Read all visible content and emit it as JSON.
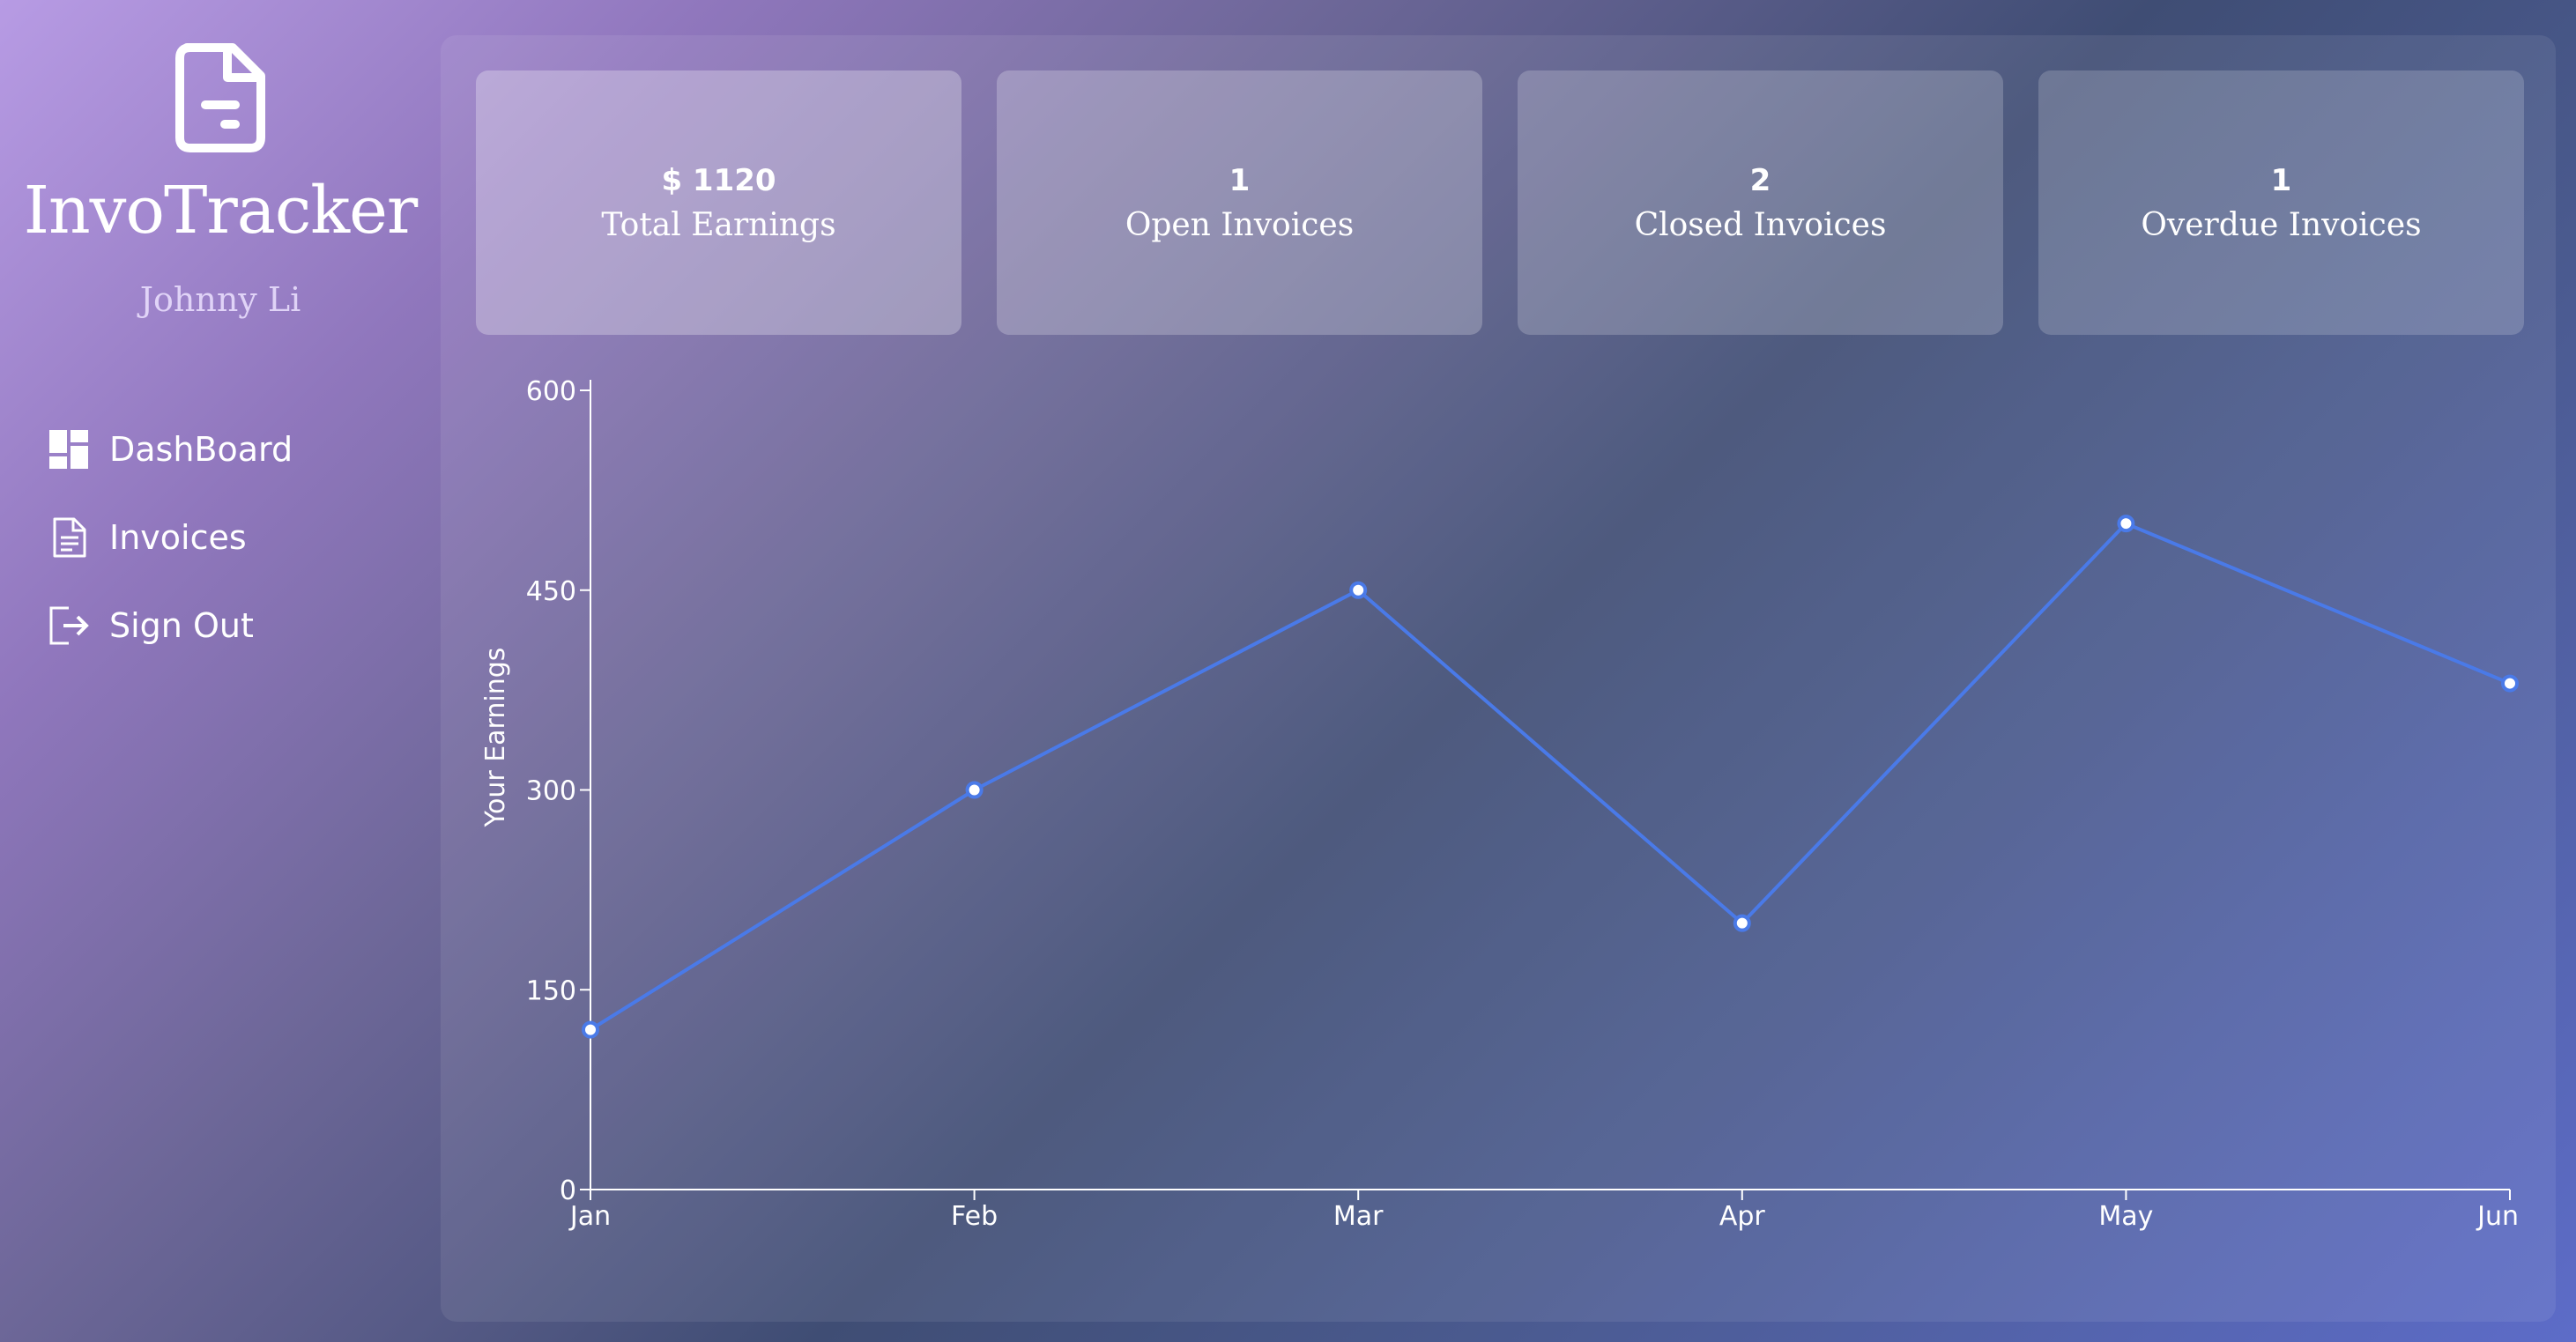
{
  "app": {
    "name": "InvoTracker",
    "user": "Johnny Li",
    "logo_icon": "invoice-document-icon"
  },
  "sidebar": {
    "items": [
      {
        "label": "DashBoard",
        "icon": "dashboard-grid-icon"
      },
      {
        "label": "Invoices",
        "icon": "invoice-document-icon"
      },
      {
        "label": "Sign Out",
        "icon": "sign-out-arrow-icon"
      }
    ]
  },
  "stats": [
    {
      "value": "$ 1120",
      "label": "Total Earnings"
    },
    {
      "value": "1",
      "label": "Open Invoices"
    },
    {
      "value": "2",
      "label": "Closed Invoices"
    },
    {
      "value": "1",
      "label": "Overdue Invoices"
    }
  ],
  "chart_data": {
    "type": "line",
    "categories": [
      "Jan",
      "Feb",
      "Mar",
      "Apr",
      "May",
      "Jun"
    ],
    "values": [
      120,
      300,
      450,
      200,
      500,
      380
    ],
    "ylabel": "Your Earnings",
    "xlabel": "",
    "ylim": [
      0,
      600
    ],
    "yticks": [
      0,
      150,
      300,
      450,
      600
    ],
    "line_color": "#4a7ae8",
    "point_fill": "#ffffff",
    "axis_color": "#ffffff",
    "grid": false
  }
}
